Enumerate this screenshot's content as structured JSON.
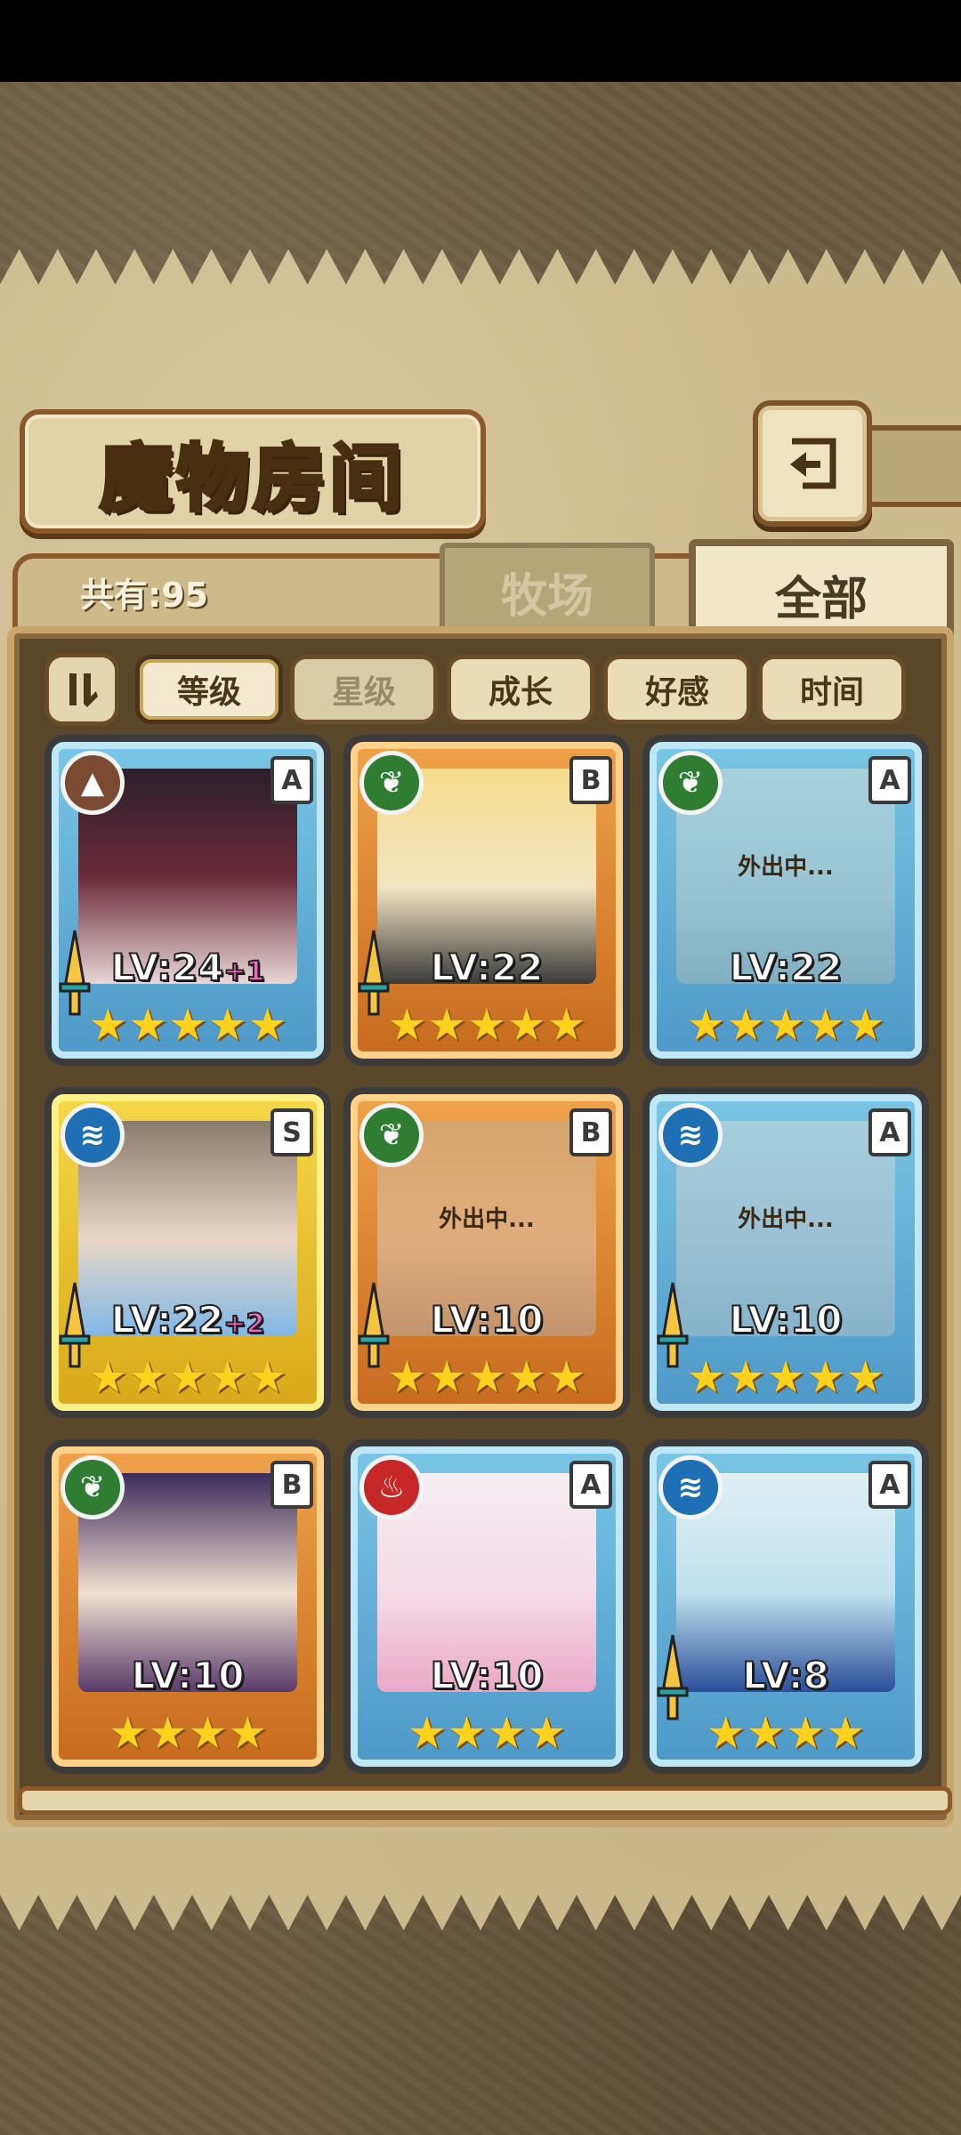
{
  "header": {
    "title": "魔物房间"
  },
  "tabs": {
    "count_label": "共有:95",
    "pasture": "牧场",
    "all": "全部"
  },
  "sort": {
    "level": "等级",
    "star": "星级",
    "growth": "成长",
    "affection": "好感",
    "time": "时间"
  },
  "cards": [
    {
      "lv": "LV:24",
      "bonus": "+1",
      "rank": "A",
      "stars": "★★★★★",
      "away": ""
    },
    {
      "lv": "LV:22",
      "bonus": "",
      "rank": "B",
      "stars": "★★★★★",
      "away": ""
    },
    {
      "lv": "LV:22",
      "bonus": "",
      "rank": "A",
      "stars": "★★★★★",
      "away": "外出中..."
    },
    {
      "lv": "LV:22",
      "bonus": "+2",
      "rank": "S",
      "stars": "★★★★★",
      "away": ""
    },
    {
      "lv": "LV:10",
      "bonus": "",
      "rank": "B",
      "stars": "★★★★★",
      "away": "外出中..."
    },
    {
      "lv": "LV:10",
      "bonus": "",
      "rank": "A",
      "stars": "★★★★★",
      "away": "外出中..."
    },
    {
      "lv": "LV:10",
      "bonus": "",
      "rank": "B",
      "stars": "★★★★",
      "away": ""
    },
    {
      "lv": "LV:10",
      "bonus": "",
      "rank": "A",
      "stars": "★★★★",
      "away": ""
    },
    {
      "lv": "LV:8",
      "bonus": "",
      "rank": "A",
      "stars": "★★★★",
      "away": ""
    }
  ],
  "icons": {
    "back": "back-arrow-icon",
    "sort_toggle": "sort-order-icon",
    "earth": "earth-element-icon",
    "nature": "leaf-element-icon",
    "water": "water-element-icon",
    "fire": "fire-element-icon",
    "sword": "sword-icon"
  },
  "colors": {
    "earth": "#7a4a32",
    "nature": "#2e7d32",
    "water": "#1f6fb5",
    "fire": "#c62828",
    "star": "#ffd21e"
  }
}
